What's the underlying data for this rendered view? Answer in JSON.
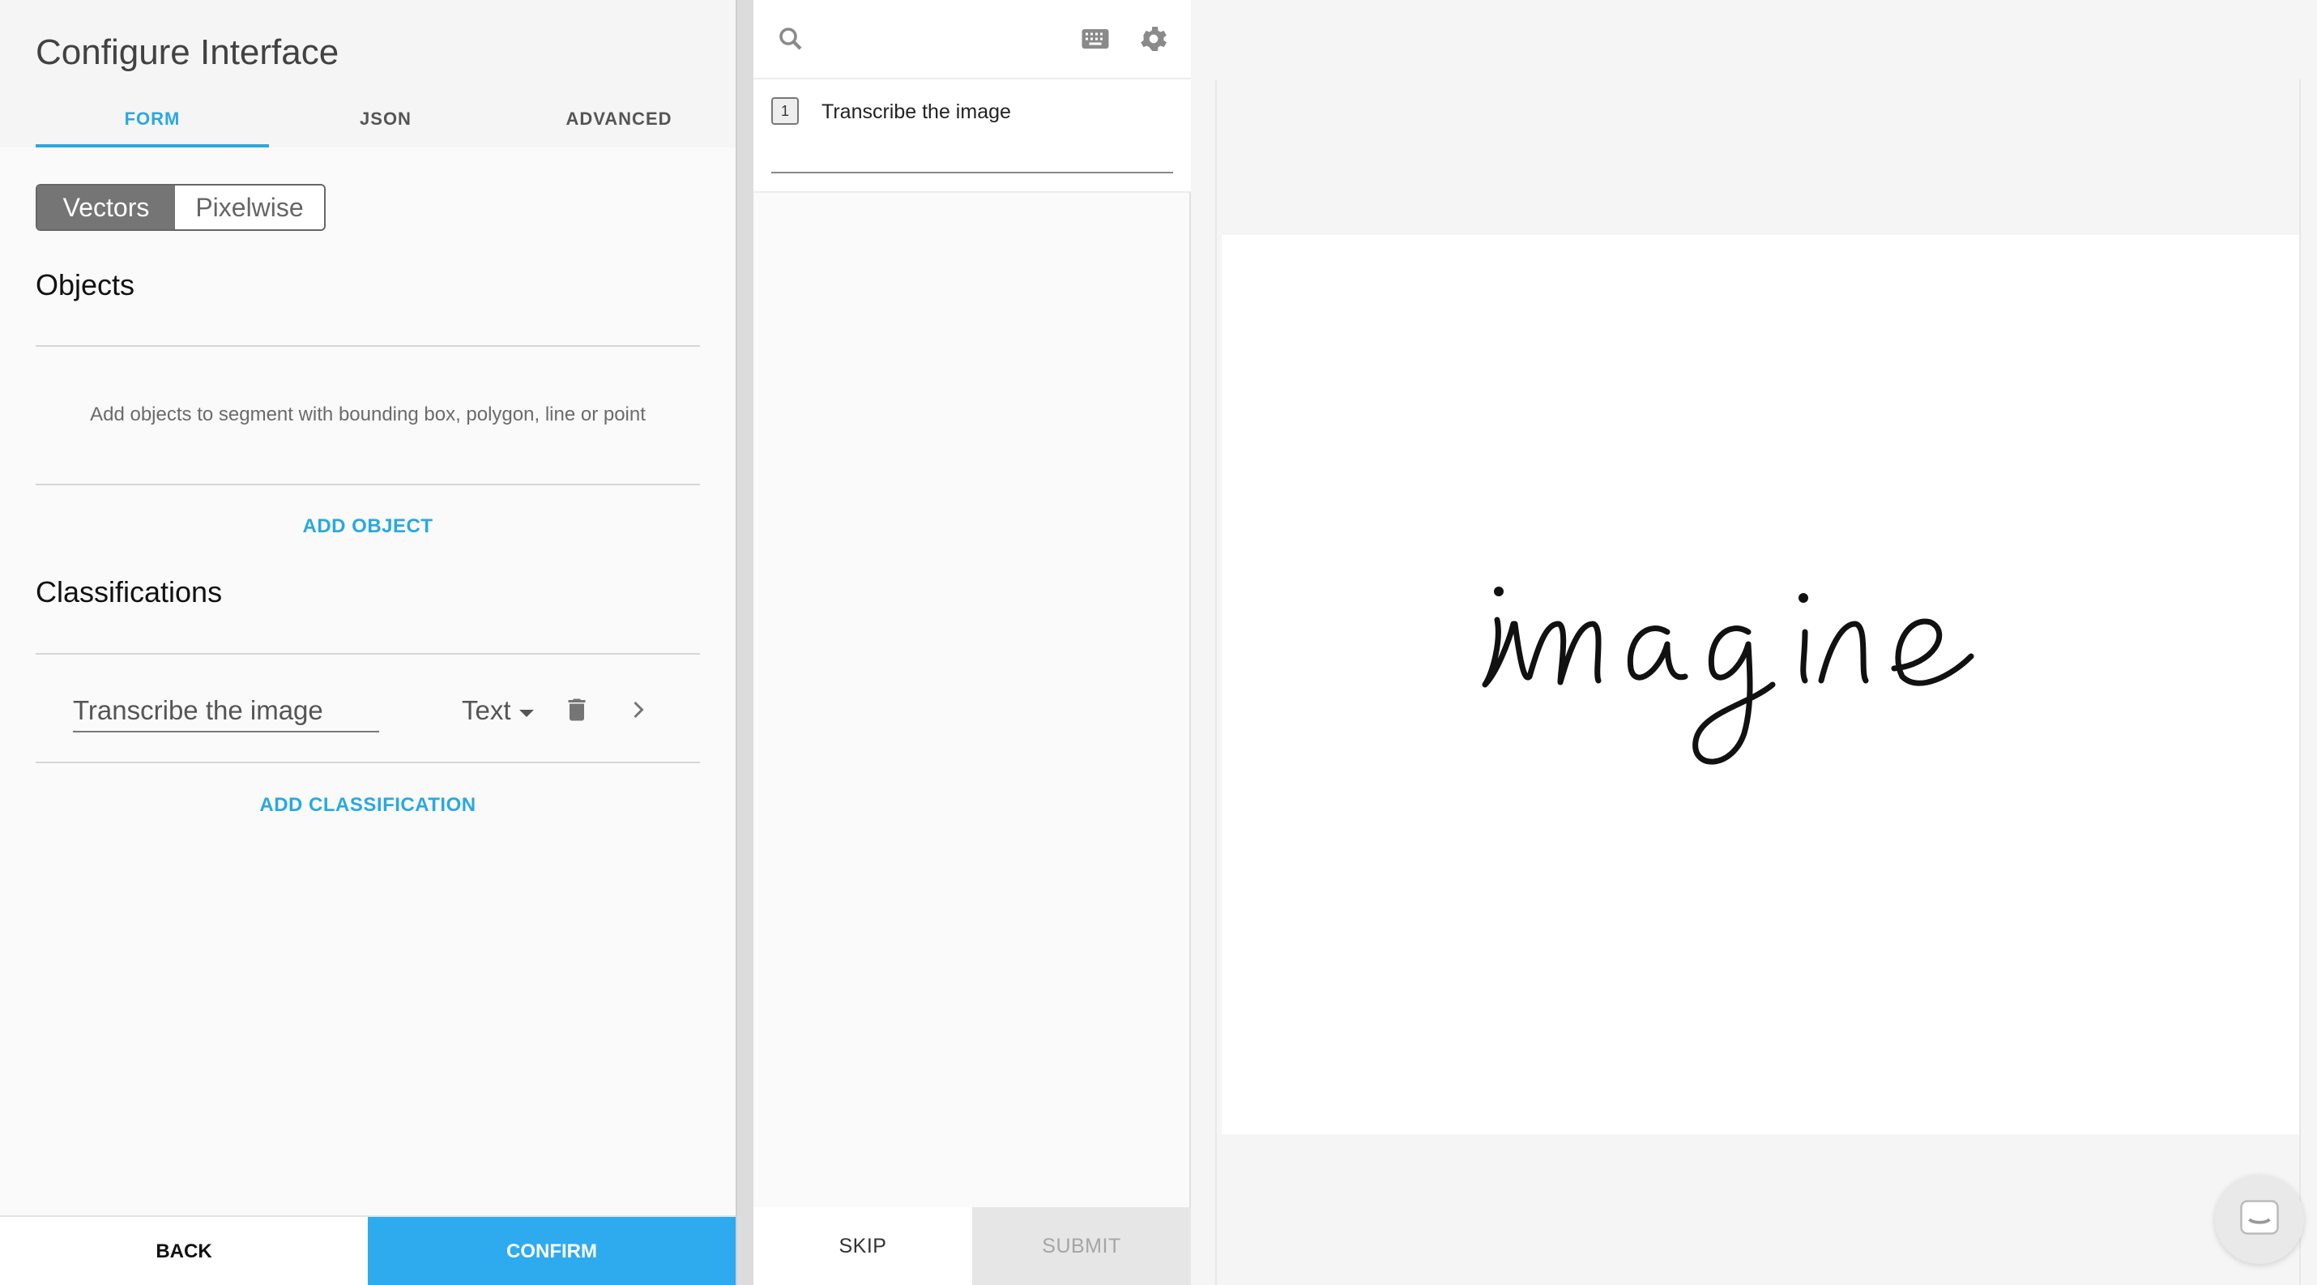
{
  "config": {
    "title": "Configure Interface",
    "tabs": [
      {
        "label": "FORM",
        "active": true
      },
      {
        "label": "JSON",
        "active": false
      },
      {
        "label": "ADVANCED",
        "active": false
      }
    ],
    "mode_toggle": {
      "options": [
        "Vectors",
        "Pixelwise"
      ],
      "selected": "Vectors"
    },
    "objects": {
      "title": "Objects",
      "hint": "Add objects to segment with bounding box, polygon, line or point",
      "add_label": "ADD OBJECT"
    },
    "classifications": {
      "title": "Classifications",
      "items": [
        {
          "name": "Transcribe the image",
          "type": "Text"
        }
      ],
      "add_label": "ADD CLASSIFICATION"
    },
    "footer": {
      "back_label": "BACK",
      "confirm_label": "CONFIRM"
    }
  },
  "labeler": {
    "icons": [
      "search-icon",
      "keyboard-icon",
      "gear-icon"
    ],
    "task": {
      "number": "1",
      "label": "Transcribe the image",
      "value": ""
    },
    "footer": {
      "skip_label": "SKIP",
      "submit_label": "SUBMIT"
    }
  },
  "viewer": {
    "image_text": "imagine",
    "chat_icon": "chat-bubble-icon"
  },
  "colors": {
    "accent": "#29a8e0",
    "confirm_bg": "#2eaaee",
    "toggle_on_bg": "#757575",
    "submit_disabled_bg": "#e6e6e6"
  }
}
